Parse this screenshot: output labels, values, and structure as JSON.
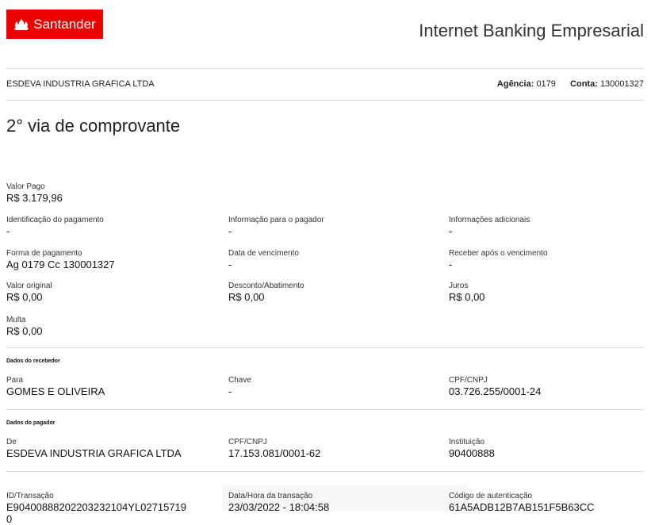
{
  "header": {
    "logo_text": "Santander",
    "title": "Internet Banking Empresarial"
  },
  "account_bar": {
    "company": "ESDEVA INDUSTRIA GRAFICA LTDA",
    "agencia_label": "Agência:",
    "agencia_value": "0179",
    "conta_label": "Conta:",
    "conta_value": "130001327"
  },
  "page_title": "2° via de comprovante",
  "payment": {
    "valor_pago": {
      "label": "Valor Pago",
      "value": "R$ 3.179,96"
    },
    "identificacao": {
      "label": "Identificação do pagamento",
      "value": "-"
    },
    "info_pagador": {
      "label": "Informação para o pagador",
      "value": "-"
    },
    "info_adicionais": {
      "label": "Informações adicionais",
      "value": "-"
    },
    "forma_pagamento": {
      "label": "Forma de pagamento",
      "value": "Ag 0179 Cc 130001327"
    },
    "data_vencimento": {
      "label": "Data de vencimento",
      "value": "-"
    },
    "receber_apos": {
      "label": "Receber após o vencimento",
      "value": "-"
    },
    "valor_original": {
      "label": "Valor original",
      "value": "R$ 0,00"
    },
    "desconto": {
      "label": "Desconto/Abatimento",
      "value": "R$ 0,00"
    },
    "juros": {
      "label": "Juros",
      "value": "R$ 0,00"
    },
    "multa": {
      "label": "Multa",
      "value": "R$ 0,00"
    }
  },
  "recebedor": {
    "section_title": "Dados do recebedor",
    "para": {
      "label": "Para",
      "value": "GOMES E OLIVEIRA"
    },
    "chave": {
      "label": "Chave",
      "value": "-"
    },
    "cpf_cnpj": {
      "label": "CPF/CNPJ",
      "value": "03.726.255/0001-24"
    }
  },
  "pagador": {
    "section_title": "Dados do pagador",
    "de": {
      "label": "De",
      "value": "ESDEVA INDUSTRIA GRAFICA LTDA"
    },
    "cpf_cnpj": {
      "label": "CPF/CNPJ",
      "value": "17.153.081/0001-62"
    },
    "instituicao": {
      "label": "Instituição",
      "value": "90400888"
    }
  },
  "transacao": {
    "id": {
      "label": "ID/Transação",
      "value": "E9040088820220323210 4YL027157190"
    },
    "id_line1": "E90400888202203232104YL02715719",
    "id_line2": "0",
    "data_hora": {
      "label": "Data/Hora da transação",
      "value": "23/03/2022 - 18:04:58"
    },
    "autenticacao": {
      "label": "Código de autenticação",
      "value": "61A5ADB12B7AB151F5B63CC"
    }
  },
  "colors": {
    "brand": "#ec0000"
  }
}
